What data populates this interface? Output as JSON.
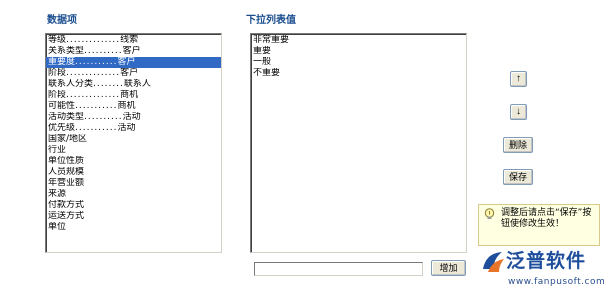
{
  "data_items": {
    "title": "数据项",
    "items": [
      {
        "name": "等级",
        "dots": "..............",
        "type": "线索"
      },
      {
        "name": "关系类型",
        "dots": "..........",
        "type": "客户"
      },
      {
        "name": "重要度",
        "dots": "...........",
        "type": "客户",
        "selected": true
      },
      {
        "name": "阶段",
        "dots": "..............",
        "type": "客户"
      },
      {
        "name": "联系人分类",
        "dots": "........",
        "type": "联系人"
      },
      {
        "name": "阶段",
        "dots": "..............",
        "type": "商机"
      },
      {
        "name": "可能性",
        "dots": "...........",
        "type": "商机"
      },
      {
        "name": "活动类型",
        "dots": "..........",
        "type": "活动"
      },
      {
        "name": "优先级",
        "dots": "...........",
        "type": "活动"
      },
      {
        "name": "国家/地区"
      },
      {
        "name": "行业"
      },
      {
        "name": "单位性质"
      },
      {
        "name": "人员规模"
      },
      {
        "name": "年营业额"
      },
      {
        "name": "来源"
      },
      {
        "name": "付款方式"
      },
      {
        "name": "运送方式"
      },
      {
        "name": "单位"
      }
    ]
  },
  "dropdown_values": {
    "title": "下拉列表值",
    "items": [
      "非常重要",
      "重要",
      "一般",
      "不重要"
    ]
  },
  "buttons": {
    "move_up": "↑",
    "move_down": "↓",
    "delete": "删除",
    "save": "保存",
    "add": "增加"
  },
  "new_value_input": {
    "value": "",
    "placeholder": ""
  },
  "tip": {
    "text": "调整后请点击“保存”按钮使修改生效！",
    "icon": "lightbulb-icon"
  },
  "logo": {
    "brand_name": "泛普软件",
    "url": "www.fanpusoft.com",
    "primary_color": "#1f4e9c",
    "accent_color": "#e8742a"
  },
  "colors": {
    "selection": "#316ac5",
    "title": "#1a4d8f",
    "tip_background": "#ffffe1"
  }
}
